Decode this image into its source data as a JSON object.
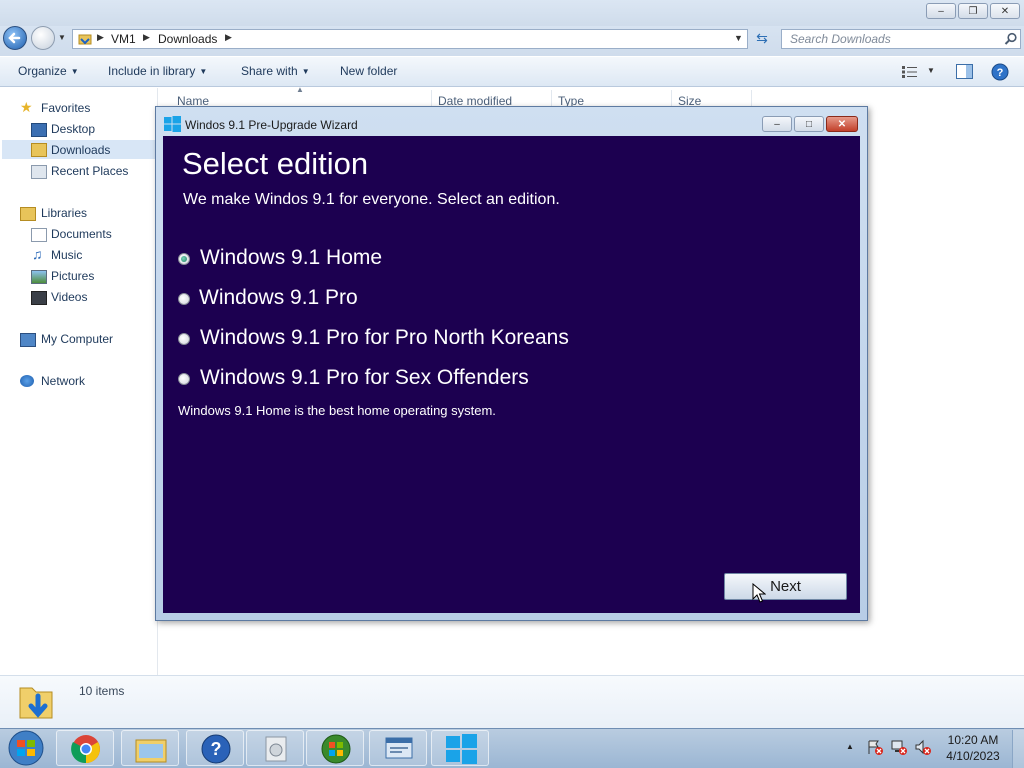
{
  "explorer": {
    "address": {
      "segments": [
        "VM1",
        "Downloads"
      ]
    },
    "search": {
      "placeholder": "Search Downloads"
    },
    "toolbar": {
      "organize": "Organize",
      "include_in_library": "Include in library",
      "share_with": "Share with",
      "new_folder": "New folder"
    },
    "columns": [
      "Name",
      "Date modified",
      "Type",
      "Size"
    ],
    "nav": {
      "favorites": {
        "label": "Favorites",
        "items": [
          "Desktop",
          "Downloads",
          "Recent Places"
        ]
      },
      "libraries": {
        "label": "Libraries",
        "items": [
          "Documents",
          "Music",
          "Pictures",
          "Videos"
        ]
      },
      "computer": "My Computer",
      "network": "Network"
    },
    "status": {
      "item_count": "10 items"
    }
  },
  "wizard": {
    "title": "Windos 9.1 Pre-Upgrade Wizard",
    "heading": "Select edition",
    "subheading": "We make Windos 9.1 for everyone. Select an edition.",
    "options": [
      {
        "label": "Windows 9.1 Home",
        "selected": true
      },
      {
        "label": "Windows 9.1 Pro",
        "selected": false
      },
      {
        "label": "Windows 9.1 Pro for Pro North Koreans",
        "selected": false
      },
      {
        "label": "Windows 9.1 Pro for Sex Offenders",
        "selected": false
      }
    ],
    "description": "Windows 9.1 Home is the best home operating system.",
    "next_label": "Next"
  },
  "taskbar": {
    "apps": [
      "start-orb",
      "chrome",
      "windows-explorer",
      "help",
      "media-disc",
      "colorful-orb",
      "system-window",
      "windows-logo"
    ],
    "clock": {
      "time": "10:20 AM",
      "date": "4/10/2023"
    }
  },
  "colors": {
    "wizard_background": "#1c0050",
    "selected_radio": "#1f7a63"
  }
}
